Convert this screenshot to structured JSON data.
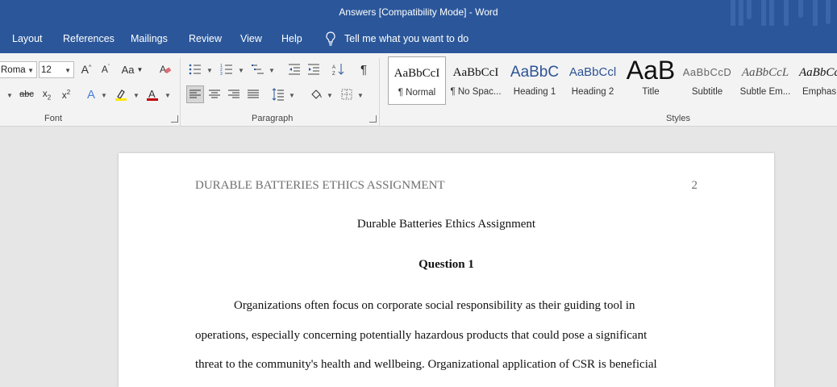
{
  "window": {
    "title": "Answers [Compatibility Mode]  -  Word"
  },
  "tabs": [
    "Layout",
    "References",
    "Mailings",
    "Review",
    "View",
    "Help"
  ],
  "tell_me": "Tell me what you want to do",
  "font": {
    "name": "Roma",
    "size": "12",
    "group_label": "Font"
  },
  "paragraph": {
    "group_label": "Paragraph"
  },
  "styles": {
    "group_label": "Styles",
    "items": [
      {
        "sample": "AaBbCcI",
        "name": "¶ Normal"
      },
      {
        "sample": "AaBbCcI",
        "name": "¶ No Spac..."
      },
      {
        "sample": "AaBbC",
        "name": "Heading 1"
      },
      {
        "sample": "AaBbCcl",
        "name": "Heading 2"
      },
      {
        "sample": "AaB",
        "name": "Title"
      },
      {
        "sample": "AaBbCcD",
        "name": "Subtitle"
      },
      {
        "sample": "AaBbCcL",
        "name": "Subtle Em..."
      },
      {
        "sample": "AaBbCc",
        "name": "Emphas"
      }
    ]
  },
  "document": {
    "header_text": "DURABLE BATTERIES ETHICS ASSIGNMENT",
    "page_number": "2",
    "title": "Durable Batteries Ethics Assignment",
    "question": "Question 1",
    "lines": [
      "Organizations often focus on corporate social responsibility as their guiding tool in",
      "operations, especially concerning potentially hazardous products that could pose a significant",
      "threat to the community's health and wellbeing. Organizational application of CSR is beneficial"
    ]
  },
  "colors": {
    "title_bar": "#2b579a",
    "ribbon": "#f3f3f3",
    "canvas": "#e6e6e6",
    "heading_blue": "#2e5395"
  }
}
